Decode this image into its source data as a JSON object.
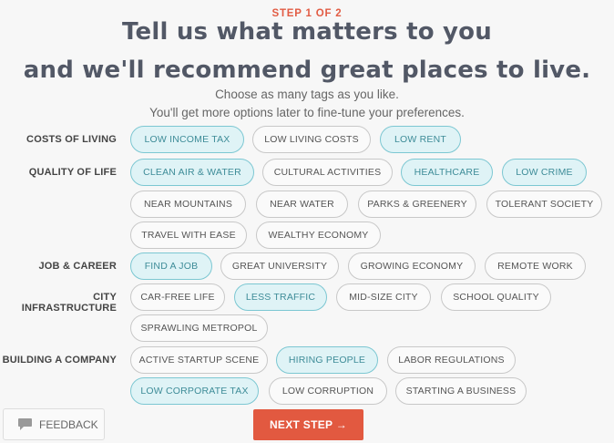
{
  "header": {
    "step": "STEP 1 OF 2",
    "title_line1": "Tell us what matters to you",
    "title_line2": "and we'll recommend great places to live.",
    "subtitle_line1": "Choose as many tags as you like.",
    "subtitle_line2": "You'll get more options later to fine-tune your preferences."
  },
  "categories": [
    {
      "label": "COSTS OF LIVING",
      "tags": [
        {
          "label": "LOW INCOME TAX",
          "selected": true
        },
        {
          "label": "LOW LIVING COSTS",
          "selected": false
        },
        {
          "label": "LOW RENT",
          "selected": true
        }
      ]
    },
    {
      "label": "QUALITY OF LIFE",
      "tags": [
        {
          "label": "CLEAN AIR & WATER",
          "selected": true
        },
        {
          "label": "CULTURAL ACTIVITIES",
          "selected": false
        },
        {
          "label": "HEALTHCARE",
          "selected": true
        },
        {
          "label": "LOW CRIME",
          "selected": true
        },
        {
          "label": "NEAR MOUNTAINS",
          "selected": false
        },
        {
          "label": "NEAR WATER",
          "selected": false
        },
        {
          "label": "PARKS & GREENERY",
          "selected": false
        },
        {
          "label": "TOLERANT SOCIETY",
          "selected": false
        },
        {
          "label": "TRAVEL WITH EASE",
          "selected": false
        },
        {
          "label": "WEALTHY ECONOMY",
          "selected": false
        }
      ]
    },
    {
      "label": "JOB & CAREER",
      "tags": [
        {
          "label": "FIND A JOB",
          "selected": true
        },
        {
          "label": "GREAT UNIVERSITY",
          "selected": false
        },
        {
          "label": "GROWING ECONOMY",
          "selected": false
        },
        {
          "label": "REMOTE WORK",
          "selected": false
        }
      ]
    },
    {
      "label": "CITY INFRASTRUCTURE",
      "tags": [
        {
          "label": "CAR-FREE LIFE",
          "selected": false
        },
        {
          "label": "LESS TRAFFIC",
          "selected": true
        },
        {
          "label": "MID-SIZE CITY",
          "selected": false
        },
        {
          "label": "SCHOOL QUALITY",
          "selected": false
        },
        {
          "label": "SPRAWLING METROPOL",
          "selected": false
        }
      ]
    },
    {
      "label": "BUILDING A COMPANY",
      "tags": [
        {
          "label": "ACTIVE STARTUP SCENE",
          "selected": false
        },
        {
          "label": "HIRING PEOPLE",
          "selected": true
        },
        {
          "label": "LABOR REGULATIONS",
          "selected": false
        },
        {
          "label": "LOW CORPORATE TAX",
          "selected": true
        },
        {
          "label": "LOW CORRUPTION",
          "selected": false
        },
        {
          "label": "STARTING A BUSINESS",
          "selected": false
        }
      ]
    }
  ],
  "footer": {
    "feedback_label": "FEEDBACK",
    "next_label": "NEXT STEP →"
  },
  "colors": {
    "accent": "#e25940",
    "selected_bg": "#dff3f6",
    "selected_border": "#7cc7d2",
    "selected_text": "#3e8c98"
  },
  "icons": {
    "feedback": "speech-bubble-icon"
  }
}
